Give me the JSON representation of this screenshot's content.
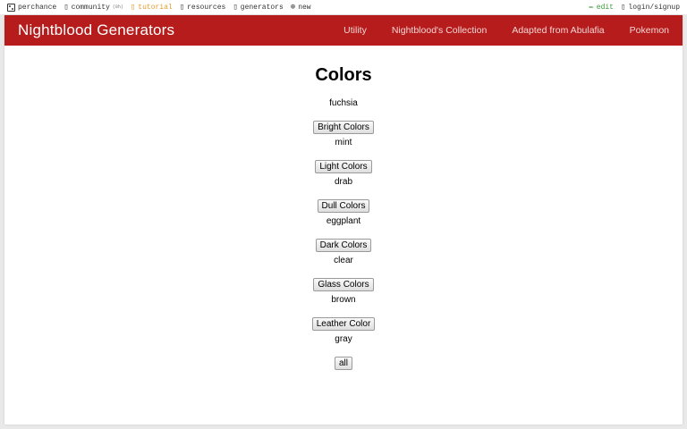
{
  "topbar": {
    "perchance": "perchance",
    "community": "community",
    "community_count": "(8h)",
    "tutorial": "tutorial",
    "resources": "resources",
    "generators": "generators",
    "new": "new",
    "edit": "edit",
    "login": "login/signup"
  },
  "navbar": {
    "brand": "Nightblood Generators",
    "links": [
      "Utility",
      "Nightblood's Collection",
      "Adapted from Abulafia",
      "Pokemon"
    ]
  },
  "main": {
    "title": "Colors",
    "rows": [
      {
        "result": "fuchsia",
        "button": "Bright Colors"
      },
      {
        "result": "mint",
        "button": "Light Colors"
      },
      {
        "result": "drab",
        "button": "Dull Colors"
      },
      {
        "result": "eggplant",
        "button": "Dark Colors"
      },
      {
        "result": "clear",
        "button": "Glass Colors"
      },
      {
        "result": "brown",
        "button": "Leather Color"
      },
      {
        "result": "gray",
        "button": "all"
      }
    ]
  },
  "colors": {
    "navbar_bg": "#b71c1c",
    "tutorial_link": "#e39b2b",
    "edit_link": "#3a9a3a"
  }
}
